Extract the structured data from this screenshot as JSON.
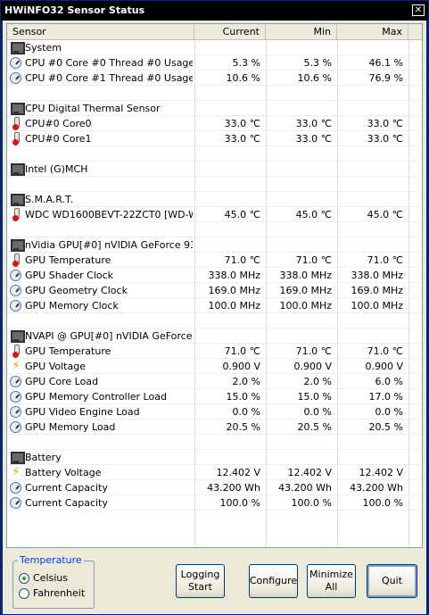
{
  "window": {
    "title": "HWiNFO32 Sensor Status",
    "close_glyph": "✕"
  },
  "columns": {
    "sensor": "Sensor",
    "current": "Current",
    "min": "Min",
    "max": "Max"
  },
  "rows": [
    {
      "type": "group",
      "name": "System"
    },
    {
      "type": "gauge",
      "name": "CPU #0 Core #0 Thread #0 Usage",
      "current": "5.3 %",
      "min": "5.3 %",
      "max": "46.1 %"
    },
    {
      "type": "gauge",
      "name": "CPU #0 Core #1 Thread #0 Usage",
      "current": "10.6 %",
      "min": "10.6 %",
      "max": "76.9 %"
    },
    {
      "type": "blank"
    },
    {
      "type": "group",
      "name": "CPU Digital Thermal Sensor"
    },
    {
      "type": "temp",
      "name": "CPU#0 Core0",
      "current": "33.0 ℃",
      "min": "33.0 ℃",
      "max": "33.0 ℃"
    },
    {
      "type": "temp",
      "name": "CPU#0 Core1",
      "current": "33.0 ℃",
      "min": "33.0 ℃",
      "max": "33.0 ℃"
    },
    {
      "type": "blank"
    },
    {
      "type": "group",
      "name": "Intel (G)MCH"
    },
    {
      "type": "blank"
    },
    {
      "type": "group",
      "name": "S.M.A.R.T."
    },
    {
      "type": "temp",
      "name": "WDC WD1600BEVT-22ZCT0 [WD-W...",
      "current": "45.0 ℃",
      "min": "45.0 ℃",
      "max": "45.0 ℃"
    },
    {
      "type": "blank"
    },
    {
      "type": "group",
      "name": "nVidia GPU[#0] nVIDIA GeForce 93..."
    },
    {
      "type": "temp",
      "name": "GPU Temperature",
      "current": "71.0 ℃",
      "min": "71.0 ℃",
      "max": "71.0 ℃"
    },
    {
      "type": "gauge",
      "name": "GPU Shader Clock",
      "current": "338.0 MHz",
      "min": "338.0 MHz",
      "max": "338.0 MHz"
    },
    {
      "type": "gauge",
      "name": "GPU Geometry Clock",
      "current": "169.0 MHz",
      "min": "169.0 MHz",
      "max": "169.0 MHz"
    },
    {
      "type": "gauge",
      "name": "GPU Memory Clock",
      "current": "100.0 MHz",
      "min": "100.0 MHz",
      "max": "100.0 MHz"
    },
    {
      "type": "blank"
    },
    {
      "type": "group",
      "name": "NVAPI @ GPU[#0] nVIDIA GeForce ..."
    },
    {
      "type": "temp",
      "name": "GPU Temperature",
      "current": "71.0 ℃",
      "min": "71.0 ℃",
      "max": "71.0 ℃"
    },
    {
      "type": "volt",
      "name": "GPU Voltage",
      "current": "0.900 V",
      "min": "0.900 V",
      "max": "0.900 V"
    },
    {
      "type": "gauge",
      "name": "GPU Core Load",
      "current": "2.0 %",
      "min": "2.0 %",
      "max": "6.0 %"
    },
    {
      "type": "gauge",
      "name": "GPU Memory Controller Load",
      "current": "15.0 %",
      "min": "15.0 %",
      "max": "17.0 %"
    },
    {
      "type": "gauge",
      "name": "GPU Video Engine Load",
      "current": "0.0 %",
      "min": "0.0 %",
      "max": "0.0 %"
    },
    {
      "type": "gauge",
      "name": "GPU Memory Load",
      "current": "20.5 %",
      "min": "20.5 %",
      "max": "20.5 %"
    },
    {
      "type": "blank"
    },
    {
      "type": "group",
      "name": "Battery"
    },
    {
      "type": "volt",
      "name": "Battery Voltage",
      "current": "12.402 V",
      "min": "12.402 V",
      "max": "12.402 V"
    },
    {
      "type": "gauge",
      "name": "Current Capacity",
      "current": "43.200 Wh",
      "min": "43.200 Wh",
      "max": "43.200 Wh"
    },
    {
      "type": "gauge",
      "name": "Current Capacity",
      "current": "100.0 %",
      "min": "100.0 %",
      "max": "100.0 %"
    }
  ],
  "temperature": {
    "legend": "Temperature",
    "celsius": "Celsius",
    "fahrenheit": "Fahrenheit",
    "selected": "celsius"
  },
  "buttons": {
    "logging": [
      "Logging",
      "Start"
    ],
    "configure": "Configure",
    "minimize": [
      "Minimize",
      "All"
    ],
    "quit": "Quit"
  },
  "colors": {
    "title_bg": "#000000",
    "client_bg": "#ece9d8",
    "legend_text": "#0046d5"
  }
}
